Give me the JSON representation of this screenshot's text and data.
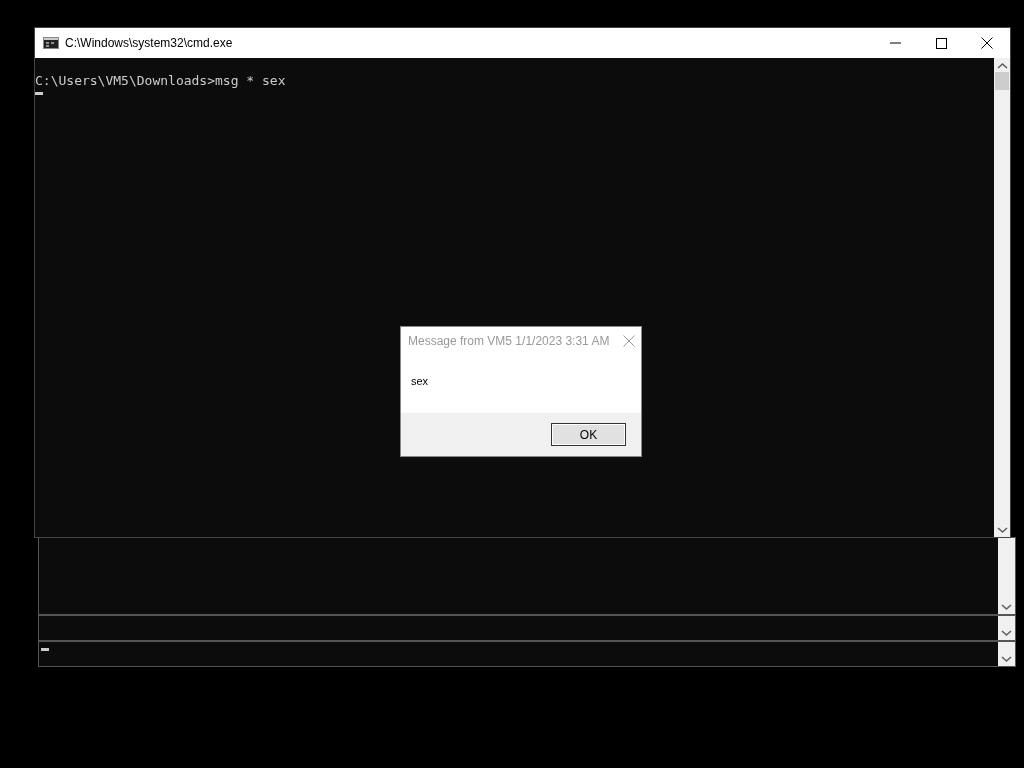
{
  "window": {
    "title": "C:\\Windows\\system32\\cmd.exe"
  },
  "console": {
    "lines": [
      "C:\\Users\\VM5\\Downloads>msg * sex"
    ]
  },
  "message_box": {
    "title": "Message from VM5 1/1/2023 3:31 AM",
    "text": "sex",
    "button": "OK"
  }
}
